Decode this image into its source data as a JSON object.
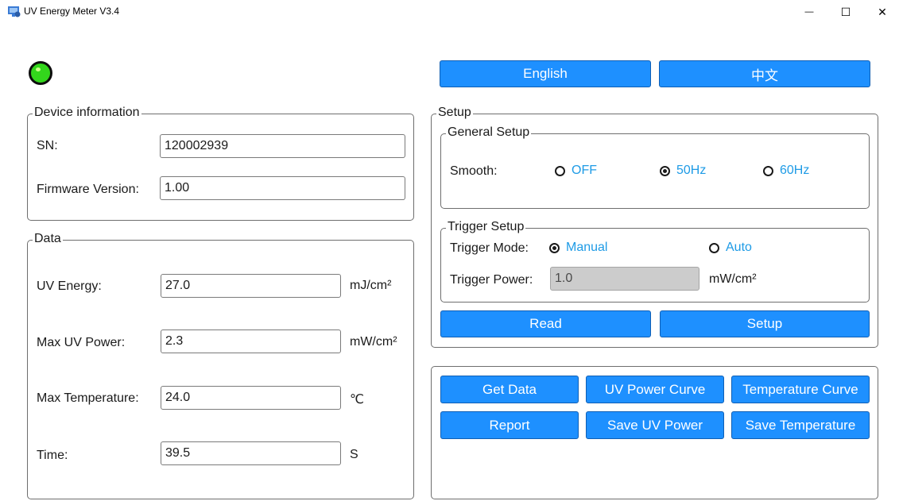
{
  "window": {
    "title": "UV Energy Meter V3.4",
    "minimize_glyph": "—",
    "maximize_glyph": "☐",
    "close_glyph": "✕"
  },
  "status_led": {
    "color": "#33d61c"
  },
  "language": {
    "english_label": "English",
    "chinese_label": "中文"
  },
  "device_info": {
    "title": "Device information",
    "sn_label": "SN:",
    "sn_value": "120002939",
    "firmware_label": "Firmware Version:",
    "firmware_value": "1.00"
  },
  "data": {
    "title": "Data",
    "uv_energy_label": "UV Energy:",
    "uv_energy_value": "27.0",
    "uv_energy_unit": "mJ/cm²",
    "max_uv_power_label": "Max UV Power:",
    "max_uv_power_value": "2.3",
    "max_uv_power_unit": "mW/cm²",
    "max_temp_label": "Max Temperature:",
    "max_temp_value": "24.0",
    "max_temp_unit": "℃",
    "time_label": "Time:",
    "time_value": "39.5",
    "time_unit": "S"
  },
  "setup": {
    "title": "Setup",
    "general": {
      "title": "General Setup",
      "smooth_label": "Smooth:",
      "options": [
        "OFF",
        "50Hz",
        "60Hz"
      ],
      "selected": "50Hz"
    },
    "trigger": {
      "title": "Trigger Setup",
      "mode_label": "Trigger Mode:",
      "mode_options": [
        "Manual",
        "Auto"
      ],
      "mode_selected": "Manual",
      "power_label": "Trigger Power:",
      "power_value": "1.0",
      "power_unit": "mW/cm²"
    },
    "read_label": "Read",
    "setup_label": "Setup"
  },
  "actions": {
    "get_data": "Get Data",
    "uv_power_curve": "UV Power Curve",
    "temperature_curve": "Temperature Curve",
    "report": "Report",
    "save_uv_power": "Save UV Power",
    "save_temperature": "Save Temperature"
  },
  "colors": {
    "button_blue": "#1e90ff",
    "radio_text": "#1e9be6",
    "led_green": "#33d61c"
  }
}
